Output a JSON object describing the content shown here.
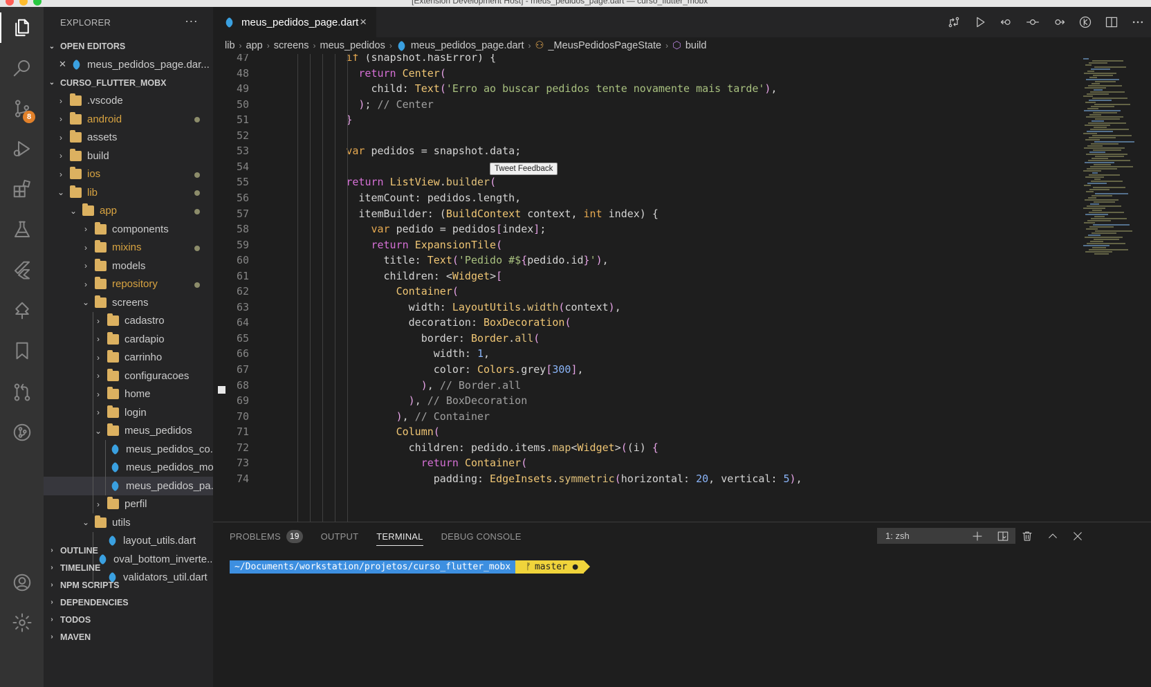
{
  "window": {
    "title": "[Extension Development Host] - meus_pedidos_page.dart — curso_flutter_mobx"
  },
  "activity_bar": {
    "items": [
      {
        "name": "explorer",
        "icon": "files-icon"
      },
      {
        "name": "search",
        "icon": "search-icon"
      },
      {
        "name": "source-control",
        "icon": "source-control-icon",
        "badge": "8"
      },
      {
        "name": "run-debug",
        "icon": "run-debug-icon"
      },
      {
        "name": "extensions",
        "icon": "extensions-icon"
      },
      {
        "name": "testing",
        "icon": "flask-icon"
      },
      {
        "name": "flutter",
        "icon": "flutter-icon"
      },
      {
        "name": "tree",
        "icon": "tree-icon"
      },
      {
        "name": "bookmarks",
        "icon": "bookmark-icon"
      },
      {
        "name": "pull-requests",
        "icon": "pull-request-icon"
      },
      {
        "name": "git-graph",
        "icon": "git-graph-icon"
      }
    ],
    "bottom": [
      {
        "name": "accounts",
        "icon": "account-icon"
      },
      {
        "name": "manage",
        "icon": "gear-icon"
      }
    ]
  },
  "sidebar": {
    "title": "EXPLORER",
    "more": "···",
    "open_editors_label": "OPEN EDITORS",
    "open_editor_file": "meus_pedidos_page.dar...",
    "project_label": "CURSO_FLUTTER_MOBX",
    "tree": [
      {
        "label": ".vscode",
        "depth": 0,
        "type": "folder",
        "open": false,
        "modified": false
      },
      {
        "label": "android",
        "depth": 0,
        "type": "folder",
        "open": false,
        "modified": true
      },
      {
        "label": "assets",
        "depth": 0,
        "type": "folder",
        "open": false,
        "modified": false
      },
      {
        "label": "build",
        "depth": 0,
        "type": "folder",
        "open": false,
        "modified": false
      },
      {
        "label": "ios",
        "depth": 0,
        "type": "folder",
        "open": false,
        "modified": true
      },
      {
        "label": "lib",
        "depth": 0,
        "type": "folder",
        "open": true,
        "modified": true
      },
      {
        "label": "app",
        "depth": 1,
        "type": "folder",
        "open": true,
        "modified": true
      },
      {
        "label": "components",
        "depth": 2,
        "type": "folder",
        "open": false,
        "modified": false
      },
      {
        "label": "mixins",
        "depth": 2,
        "type": "folder",
        "open": false,
        "modified": true
      },
      {
        "label": "models",
        "depth": 2,
        "type": "folder",
        "open": false,
        "modified": false
      },
      {
        "label": "repository",
        "depth": 2,
        "type": "folder",
        "open": false,
        "modified": true
      },
      {
        "label": "screens",
        "depth": 2,
        "type": "folder",
        "open": true,
        "modified": false
      },
      {
        "label": "cadastro",
        "depth": 3,
        "type": "folder",
        "open": false,
        "modified": false
      },
      {
        "label": "cardapio",
        "depth": 3,
        "type": "folder",
        "open": false,
        "modified": false
      },
      {
        "label": "carrinho",
        "depth": 3,
        "type": "folder",
        "open": false,
        "modified": false
      },
      {
        "label": "configuracoes",
        "depth": 3,
        "type": "folder",
        "open": false,
        "modified": false
      },
      {
        "label": "home",
        "depth": 3,
        "type": "folder",
        "open": false,
        "modified": false
      },
      {
        "label": "login",
        "depth": 3,
        "type": "folder",
        "open": false,
        "modified": false
      },
      {
        "label": "meus_pedidos",
        "depth": 3,
        "type": "folder",
        "open": true,
        "modified": false
      },
      {
        "label": "meus_pedidos_co...",
        "depth": 4,
        "type": "dart",
        "modified": false
      },
      {
        "label": "meus_pedidos_mo...",
        "depth": 4,
        "type": "dart",
        "modified": false
      },
      {
        "label": "meus_pedidos_pa...",
        "depth": 4,
        "type": "dart",
        "modified": false,
        "selected": true
      },
      {
        "label": "perfil",
        "depth": 3,
        "type": "folder",
        "open": false,
        "modified": false
      },
      {
        "label": "utils",
        "depth": 2,
        "type": "folder",
        "open": true,
        "modified": false
      },
      {
        "label": "layout_utils.dart",
        "depth": 3,
        "type": "dart",
        "modified": false
      },
      {
        "label": "oval_bottom_inverte...",
        "depth": 3,
        "type": "dart",
        "modified": false
      },
      {
        "label": "validators_util.dart",
        "depth": 3,
        "type": "dart",
        "modified": false
      }
    ],
    "sections": [
      "OUTLINE",
      "TIMELINE",
      "NPM SCRIPTS",
      "DEPENDENCIES",
      "TODOS",
      "MAVEN"
    ]
  },
  "editor": {
    "tab_label": "meus_pedidos_page.dart",
    "tab_close": "×",
    "breadcrumb": [
      "lib",
      "app",
      "screens",
      "meus_pedidos",
      "meus_pedidos_page.dart",
      "_MeusPedidosPageState",
      "build"
    ],
    "tooltip": "Tweet Feedback",
    "lines": [
      {
        "n": "47",
        "indent": 12,
        "tokens": [
          [
            "kw2",
            "if"
          ],
          [
            "t",
            " (snapshot.hasError) {"
          ]
        ]
      },
      {
        "n": "48",
        "indent": 14,
        "tokens": [
          [
            "kw",
            "return "
          ],
          [
            "cls",
            "Center"
          ],
          [
            "brk",
            "("
          ]
        ]
      },
      {
        "n": "49",
        "indent": 16,
        "tokens": [
          [
            "t",
            "child: "
          ],
          [
            "cls",
            "Text"
          ],
          [
            "brk",
            "("
          ],
          [
            "str",
            "'Erro ao buscar pedidos tente novamente mais tarde'"
          ],
          [
            "brk",
            ")"
          ],
          [
            "t",
            ","
          ]
        ]
      },
      {
        "n": "50",
        "indent": 14,
        "tokens": [
          [
            "brk",
            ")"
          ],
          [
            "t",
            "; "
          ],
          [
            "com",
            "// Center"
          ]
        ]
      },
      {
        "n": "51",
        "indent": 12,
        "tokens": [
          [
            "brk",
            "}"
          ]
        ]
      },
      {
        "n": "52",
        "indent": 12,
        "tokens": []
      },
      {
        "n": "53",
        "indent": 12,
        "tokens": [
          [
            "kw2",
            "var "
          ],
          [
            "t",
            "pedidos = snapshot.data;"
          ]
        ]
      },
      {
        "n": "54",
        "indent": 12,
        "tokens": []
      },
      {
        "n": "55",
        "indent": 12,
        "tokens": [
          [
            "kw",
            "return "
          ],
          [
            "cls",
            "ListView"
          ],
          [
            "t",
            "."
          ],
          [
            "fn",
            "builder"
          ],
          [
            "brk",
            "("
          ]
        ]
      },
      {
        "n": "56",
        "indent": 14,
        "tokens": [
          [
            "t",
            "itemCount: pedidos.length,"
          ]
        ]
      },
      {
        "n": "57",
        "indent": 14,
        "tokens": [
          [
            "t",
            "itemBuilder: ("
          ],
          [
            "cls",
            "BuildContext"
          ],
          [
            "t",
            " context, "
          ],
          [
            "kw2",
            "int"
          ],
          [
            "t",
            " index) {"
          ]
        ]
      },
      {
        "n": "58",
        "indent": 16,
        "tokens": [
          [
            "kw2",
            "var "
          ],
          [
            "t",
            "pedido = pedidos"
          ],
          [
            "brk",
            "["
          ],
          [
            "t",
            "index"
          ],
          [
            "brk",
            "]"
          ],
          [
            "t",
            ";"
          ]
        ]
      },
      {
        "n": "59",
        "indent": 16,
        "tokens": [
          [
            "kw",
            "return "
          ],
          [
            "cls",
            "ExpansionTile"
          ],
          [
            "brk",
            "("
          ]
        ]
      },
      {
        "n": "60",
        "indent": 18,
        "tokens": [
          [
            "t",
            "title: "
          ],
          [
            "cls",
            "Text"
          ],
          [
            "brk",
            "("
          ],
          [
            "str",
            "'Pedido #$"
          ],
          [
            "brk",
            "{"
          ],
          [
            "t",
            "pedido.id"
          ],
          [
            "brk",
            "}"
          ],
          [
            "str",
            "'"
          ],
          [
            "brk",
            ")"
          ],
          [
            "t",
            ","
          ]
        ]
      },
      {
        "n": "61",
        "indent": 18,
        "tokens": [
          [
            "t",
            "children: <"
          ],
          [
            "cls",
            "Widget"
          ],
          [
            "t",
            ">"
          ],
          [
            "brk",
            "["
          ]
        ]
      },
      {
        "n": "62",
        "indent": 20,
        "tokens": [
          [
            "cls",
            "Container"
          ],
          [
            "brk",
            "("
          ]
        ]
      },
      {
        "n": "63",
        "indent": 22,
        "tokens": [
          [
            "t",
            "width: "
          ],
          [
            "cls",
            "LayoutUtils"
          ],
          [
            "t",
            "."
          ],
          [
            "fn",
            "width"
          ],
          [
            "brk",
            "("
          ],
          [
            "t",
            "context"
          ],
          [
            "brk",
            ")"
          ],
          [
            "t",
            ","
          ]
        ]
      },
      {
        "n": "64",
        "indent": 22,
        "tokens": [
          [
            "t",
            "decoration: "
          ],
          [
            "cls",
            "BoxDecoration"
          ],
          [
            "brk",
            "("
          ]
        ]
      },
      {
        "n": "65",
        "indent": 24,
        "tokens": [
          [
            "t",
            "border: "
          ],
          [
            "cls",
            "Border"
          ],
          [
            "t",
            "."
          ],
          [
            "fn",
            "all"
          ],
          [
            "brk",
            "("
          ]
        ]
      },
      {
        "n": "66",
        "indent": 26,
        "tokens": [
          [
            "t",
            "width: "
          ],
          [
            "num",
            "1"
          ],
          [
            "t",
            ","
          ]
        ]
      },
      {
        "n": "67",
        "indent": 26,
        "tokens": [
          [
            "t",
            "color: "
          ],
          [
            "cls",
            "Colors"
          ],
          [
            "t",
            ".grey"
          ],
          [
            "brk",
            "["
          ],
          [
            "num",
            "300"
          ],
          [
            "brk",
            "]"
          ],
          [
            "t",
            ","
          ]
        ]
      },
      {
        "n": "68",
        "indent": 24,
        "tokens": [
          [
            "brk",
            ")"
          ],
          [
            "t",
            ", "
          ],
          [
            "com",
            "// Border.all"
          ]
        ]
      },
      {
        "n": "69",
        "indent": 22,
        "tokens": [
          [
            "brk",
            ")"
          ],
          [
            "t",
            ", "
          ],
          [
            "com",
            "// BoxDecoration"
          ]
        ]
      },
      {
        "n": "70",
        "indent": 20,
        "tokens": [
          [
            "brk",
            ")"
          ],
          [
            "t",
            ", "
          ],
          [
            "com",
            "// Container"
          ]
        ]
      },
      {
        "n": "71",
        "indent": 20,
        "tokens": [
          [
            "cls",
            "Column"
          ],
          [
            "brk",
            "("
          ]
        ]
      },
      {
        "n": "72",
        "indent": 22,
        "tokens": [
          [
            "t",
            "children: pedido.items."
          ],
          [
            "fn",
            "map"
          ],
          [
            "t",
            "<"
          ],
          [
            "cls",
            "Widget"
          ],
          [
            "t",
            ">"
          ],
          [
            "brk",
            "("
          ],
          [
            "t",
            "(i) "
          ],
          [
            "brk",
            "{"
          ]
        ]
      },
      {
        "n": "73",
        "indent": 24,
        "tokens": [
          [
            "kw",
            "return "
          ],
          [
            "cls",
            "Container"
          ],
          [
            "brk",
            "("
          ]
        ]
      },
      {
        "n": "74",
        "indent": 26,
        "tokens": [
          [
            "t",
            "padding: "
          ],
          [
            "cls",
            "EdgeInsets"
          ],
          [
            "t",
            "."
          ],
          [
            "fn",
            "symmetric"
          ],
          [
            "brk",
            "("
          ],
          [
            "t",
            "horizontal: "
          ],
          [
            "num",
            "20"
          ],
          [
            "t",
            ", vertical: "
          ],
          [
            "num",
            "5"
          ],
          [
            "brk",
            ")"
          ],
          [
            "t",
            ","
          ]
        ]
      }
    ]
  },
  "panel": {
    "tabs": [
      {
        "label": "PROBLEMS",
        "badge": "19"
      },
      {
        "label": "OUTPUT"
      },
      {
        "label": "TERMINAL",
        "active": true
      },
      {
        "label": "DEBUG CONSOLE"
      }
    ],
    "terminal_select": "1: zsh",
    "prompt_path": "~/Documents/workstation/projetos/curso_flutter_mobx",
    "prompt_branch": "master ●",
    "prompt_branch_icon": "ᚠ"
  },
  "colors": {
    "accent_blue": "#3d8fe0",
    "branch_yellow": "#f0d43b",
    "badge_orange": "#e2812a",
    "folder_yellow": "#dcb160",
    "dart_blue": "#3aa0e0"
  }
}
